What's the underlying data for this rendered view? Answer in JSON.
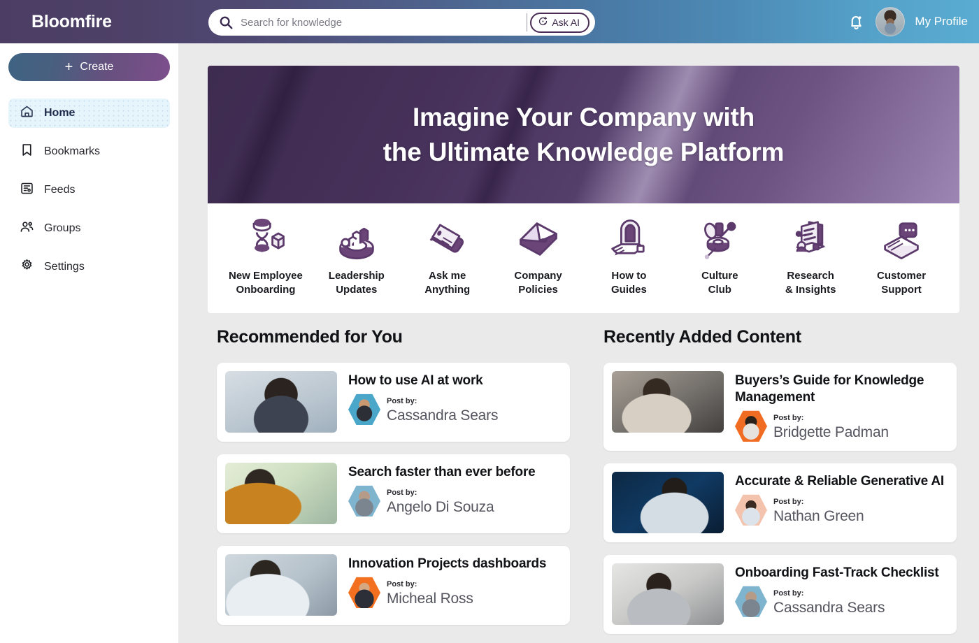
{
  "header": {
    "brand": "Bloomfire",
    "search": {
      "placeholder": "Search for knowledge",
      "value": "",
      "icon": "search-icon"
    },
    "ask_ai_label": "Ask AI",
    "ask_ai_icon": "sparkle-ai-icon",
    "notifications_icon": "bell-icon",
    "profile_label": "My Profile",
    "profile_avatar": "user-avatar"
  },
  "sidebar": {
    "create_label": "Create",
    "create_icon": "plus-icon",
    "items": [
      {
        "label": "Home",
        "icon": "home-icon",
        "active": true
      },
      {
        "label": "Bookmarks",
        "icon": "bookmark-icon",
        "active": false
      },
      {
        "label": "Feeds",
        "icon": "feed-icon",
        "active": false
      },
      {
        "label": "Groups",
        "icon": "groups-icon",
        "active": false
      },
      {
        "label": "Settings",
        "icon": "gear-icon",
        "active": false
      }
    ]
  },
  "hero": {
    "line1": "Imagine Your Company with",
    "line2": "the Ultimate Knowledge Platform"
  },
  "categories": [
    {
      "label_line1": "New Employee",
      "label_line2": "Onboarding",
      "icon": "hourglass-person-icon"
    },
    {
      "label_line1": "Leadership",
      "label_line2": "Updates",
      "icon": "podium-chart-icon"
    },
    {
      "label_line1": "Ask me",
      "label_line2": "Anything",
      "icon": "chat-block-icon"
    },
    {
      "label_line1": "Company",
      "label_line2": "Policies",
      "icon": "policy-document-icon"
    },
    {
      "label_line1": "How to",
      "label_line2": "Guides",
      "icon": "guide-book-icon"
    },
    {
      "label_line1": "Culture",
      "label_line2": "Club",
      "icon": "culture-balloon-icon"
    },
    {
      "label_line1": "Research",
      "label_line2": "& Insights",
      "icon": "research-monitor-icon"
    },
    {
      "label_line1": "Customer",
      "label_line2": "Support",
      "icon": "support-chat-icon"
    }
  ],
  "colors": {
    "brand_purple": "#4b3d63",
    "brand_blue": "#5aacd2",
    "accent_icon": "#5b3a6b",
    "active_nav_bg": "#e6f4fc",
    "page_bg": "#eaeaea",
    "card_bg": "#ffffff"
  },
  "recommended": {
    "title": "Recommended for You",
    "cards": [
      {
        "title": "How to use AI at work",
        "post_by_label": "Post by:",
        "author": "Cassandra Sears",
        "thumb": "woman-smiling-workshop",
        "avatar_color": "#4aa7c9"
      },
      {
        "title": "Search faster than ever before",
        "post_by_label": "Post by:",
        "author": "Angelo Di Souza",
        "thumb": "woman-at-desk-window",
        "avatar_color": "#7fb4cf"
      },
      {
        "title": "Innovation Projects dashboards",
        "post_by_label": "Post by:",
        "author": "Micheal Ross",
        "thumb": "scientist-at-microscope",
        "avatar_color": "#f2701f"
      }
    ]
  },
  "recent": {
    "title": "Recently Added Content",
    "cards": [
      {
        "title": "Buyers’s Guide for Knowledge Management",
        "post_by_label": "Post by:",
        "author": "Bridgette Padman",
        "thumb": "man-with-tablet",
        "avatar_color": "#f06c22"
      },
      {
        "title": "Accurate & Reliable Generative AI",
        "post_by_label": "Post by:",
        "author": "Nathan Green",
        "thumb": "man-with-laptop-blue",
        "avatar_color": "#f3c3ad"
      },
      {
        "title": "Onboarding Fast-Track Checklist",
        "post_by_label": "Post by:",
        "author": "Cassandra Sears",
        "thumb": "two-women-meeting",
        "avatar_color": "#7fb4cf"
      }
    ]
  }
}
